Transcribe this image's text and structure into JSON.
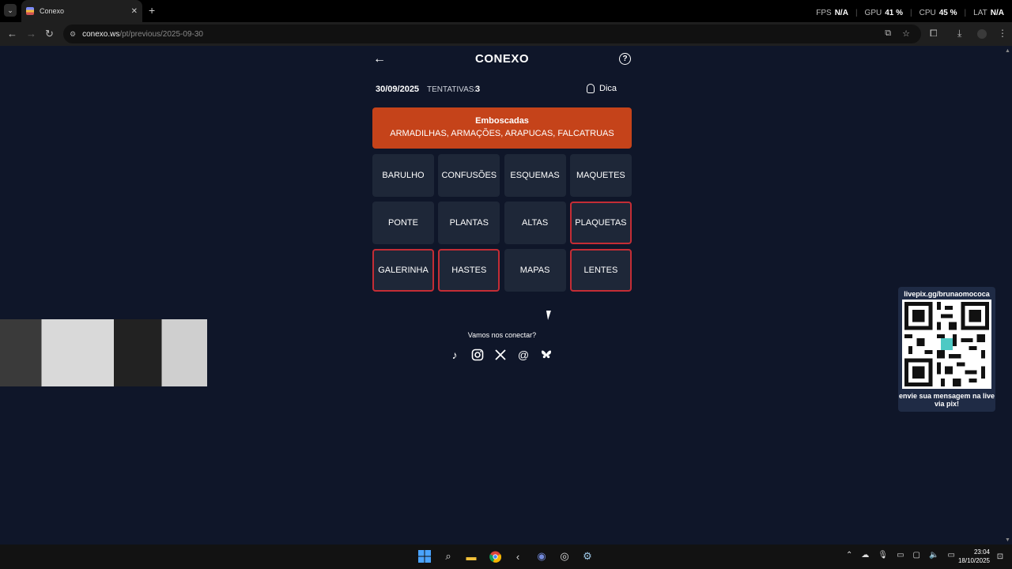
{
  "browser": {
    "tab_title": "Conexo",
    "url_host": "conexo.ws",
    "url_path": "/pt/previous/2025-09-30"
  },
  "overlay": {
    "fps_label": "FPS",
    "fps_value": "N/A",
    "gpu_label": "GPU",
    "gpu_value": "41 %",
    "cpu_label": "CPU",
    "cpu_value": "45 %",
    "lat_label": "LAT",
    "lat_value": "N/A"
  },
  "game": {
    "title": "CONEXO",
    "date": "30/09/2025",
    "attempts_label": "TENTATIVAS:",
    "attempts_value": "3",
    "hint_label": "Dica",
    "solved_group": {
      "name": "Emboscadas",
      "words": "ARMADILHAS, ARMAÇÕES, ARAPUCAS, FALCATRUAS",
      "color": "#c5431a"
    },
    "tiles": [
      {
        "word": "BARULHO",
        "selected": false
      },
      {
        "word": "CONFUSÕES",
        "selected": false
      },
      {
        "word": "ESQUEMAS",
        "selected": false
      },
      {
        "word": "MAQUETES",
        "selected": false
      },
      {
        "word": "PONTE",
        "selected": false
      },
      {
        "word": "PLANTAS",
        "selected": false
      },
      {
        "word": "ALTAS",
        "selected": false
      },
      {
        "word": "PLAQUETAS",
        "selected": true
      },
      {
        "word": "GALERINHA",
        "selected": true
      },
      {
        "word": "HASTES",
        "selected": true
      },
      {
        "word": "MAPAS",
        "selected": false
      },
      {
        "word": "LENTES",
        "selected": true
      }
    ],
    "connect_text": "Vamos nos conectar?",
    "socials": [
      "tiktok-icon",
      "instagram-icon",
      "x-icon",
      "threads-icon",
      "bluesky-icon"
    ]
  },
  "qr": {
    "top_text": "livepix.gg/brunaomococa",
    "bottom_text": "envie sua mensagem na live via pix!"
  },
  "clock": {
    "time": "23:04",
    "date": "18/10/2025"
  }
}
